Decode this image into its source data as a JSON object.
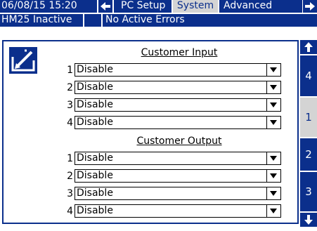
{
  "status_bar": {
    "datetime": "06/08/15 15:20",
    "tab_prev_icon": "arrow-left-icon",
    "tabs": [
      {
        "label": "PC Setup",
        "active": false
      },
      {
        "label": "System",
        "active": true
      },
      {
        "label": "Advanced",
        "active": false
      }
    ],
    "tab_next_icon": "arrow-right-icon"
  },
  "info_bar": {
    "machine_status": "HM25 Inactive",
    "error_status": "No Active Errors"
  },
  "page": {
    "edit_icon": "edit-pencil-icon",
    "customer_input": {
      "title": "Customer Input",
      "rows": [
        {
          "num": "1",
          "value": "Disable"
        },
        {
          "num": "2",
          "value": "Disable"
        },
        {
          "num": "3",
          "value": "Disable"
        },
        {
          "num": "4",
          "value": "Disable"
        }
      ]
    },
    "customer_output": {
      "title": "Customer Output",
      "rows": [
        {
          "num": "1",
          "value": "Disable"
        },
        {
          "num": "2",
          "value": "Disable"
        },
        {
          "num": "3",
          "value": "Disable"
        },
        {
          "num": "4",
          "value": "Disable"
        }
      ]
    }
  },
  "side_nav": {
    "up_icon": "arrow-up-icon",
    "pages": [
      {
        "label": "4",
        "active": false
      },
      {
        "label": "1",
        "active": true
      },
      {
        "label": "2",
        "active": false
      },
      {
        "label": "3",
        "active": false
      }
    ],
    "down_icon": "arrow-down-icon"
  },
  "colors": {
    "primary_blue": "#0b2f8c",
    "active_tab_gray": "#d4d4d4"
  }
}
